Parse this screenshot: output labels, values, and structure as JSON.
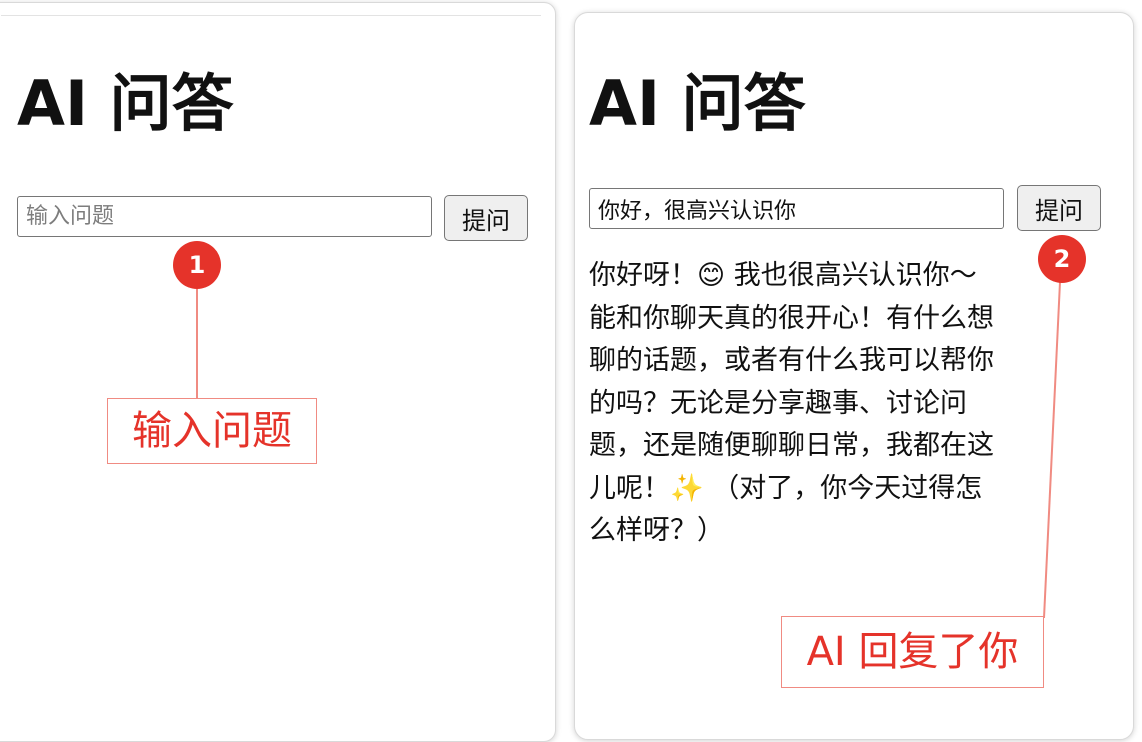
{
  "left_panel": {
    "title": "AI 问答",
    "input": {
      "value": "",
      "placeholder": "输入问题"
    },
    "ask_button": "提问"
  },
  "right_panel": {
    "title": "AI 问答",
    "input": {
      "value": "你好，很高兴认识你",
      "placeholder": ""
    },
    "ask_button": "提问",
    "answer": "你好呀！😊 我也很高兴认识你～能和你聊天真的很开心！有什么想聊的话题，或者有什么我可以帮你的吗？无论是分享趣事、讨论问题，还是随便聊聊日常，我都在这儿呢！✨ （对了，你今天过得怎么样呀？）"
  },
  "annotations": [
    {
      "number": "1",
      "label": "输入问题"
    },
    {
      "number": "2",
      "label": "AI 回复了你"
    }
  ],
  "colors": {
    "annotation_red": "#e5332a",
    "annotation_line": "#f08b82"
  }
}
